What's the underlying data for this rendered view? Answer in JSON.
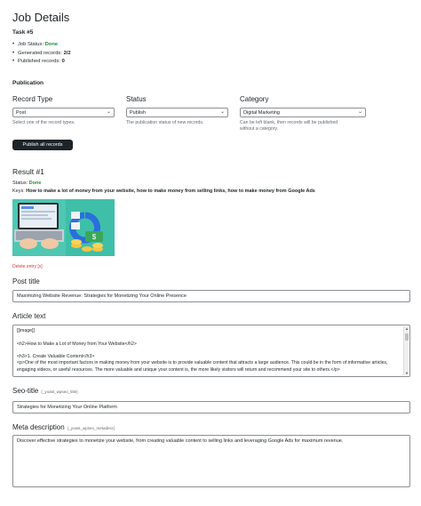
{
  "page_title": "Job Details",
  "task": "Task #5",
  "stats": {
    "job_status_label": "Job Status:",
    "job_status_value": "Done",
    "generated_label": "Generated records:",
    "generated_value": "2/2",
    "published_label": "Published records:",
    "published_value": "0"
  },
  "publication": {
    "heading": "Publication",
    "record_type": {
      "label": "Record Type",
      "value": "Post",
      "help": "Select one of the record types."
    },
    "status": {
      "label": "Status",
      "value": "Publish",
      "help": "The publication status of new records."
    },
    "category": {
      "label": "Category",
      "value": "Digital Marketing",
      "help_line1": "Can be left blank, then records will be published",
      "help_line2": "without a category."
    },
    "publish_all_button": "Publish all records"
  },
  "result": {
    "heading": "Result #1",
    "status_label": "Status:",
    "status_value": "Done",
    "keys_label": "Keys:",
    "keys_value": "How to make a lot of money from your website, how to make money from selling links, how to make money from Google Ads",
    "delete_link": "Delete entry [x]",
    "post_title_label": "Post title",
    "post_title_value": "Maximizing Website Revenue: Strategies for Monetizing Your Online Presence",
    "article_label": "Article text",
    "article_lines": [
      "[[image]]",
      "",
      "<h2>How to Make a Lot of Money from Your Website</h2>",
      "",
      "<h3>1. Create Valuable Content</h3>",
      "<p>One of the most important factors in making money from your website is to provide valuable content that attracts a large audience. This could be in the form of informative articles,",
      "engaging videos, or useful resources. The more valuable and unique your content is, the more likely visitors will return and recommend your site to others.</p>"
    ],
    "seo_title_label": "Seo-title",
    "seo_title_tag": "(_yoast_wpseo_title)",
    "seo_title_value": "Strategies for Monetizing Your Online Platform",
    "meta_label": "Meta description",
    "meta_tag": "(_yoast_wpseo_metadesc)",
    "meta_value": "Discover effective strategies to monetize your website, from creating valuable content to selling links and leveraging Google Ads for maximum revenue."
  },
  "icons": [
    "chevron-down-icon",
    "scroll-up-icon",
    "scroll-down-icon"
  ],
  "colors": {
    "done_green": "#1e8e3e",
    "delete_red": "#d63638",
    "button_dark": "#1d2327",
    "image_teal": "#3fbfa8"
  }
}
